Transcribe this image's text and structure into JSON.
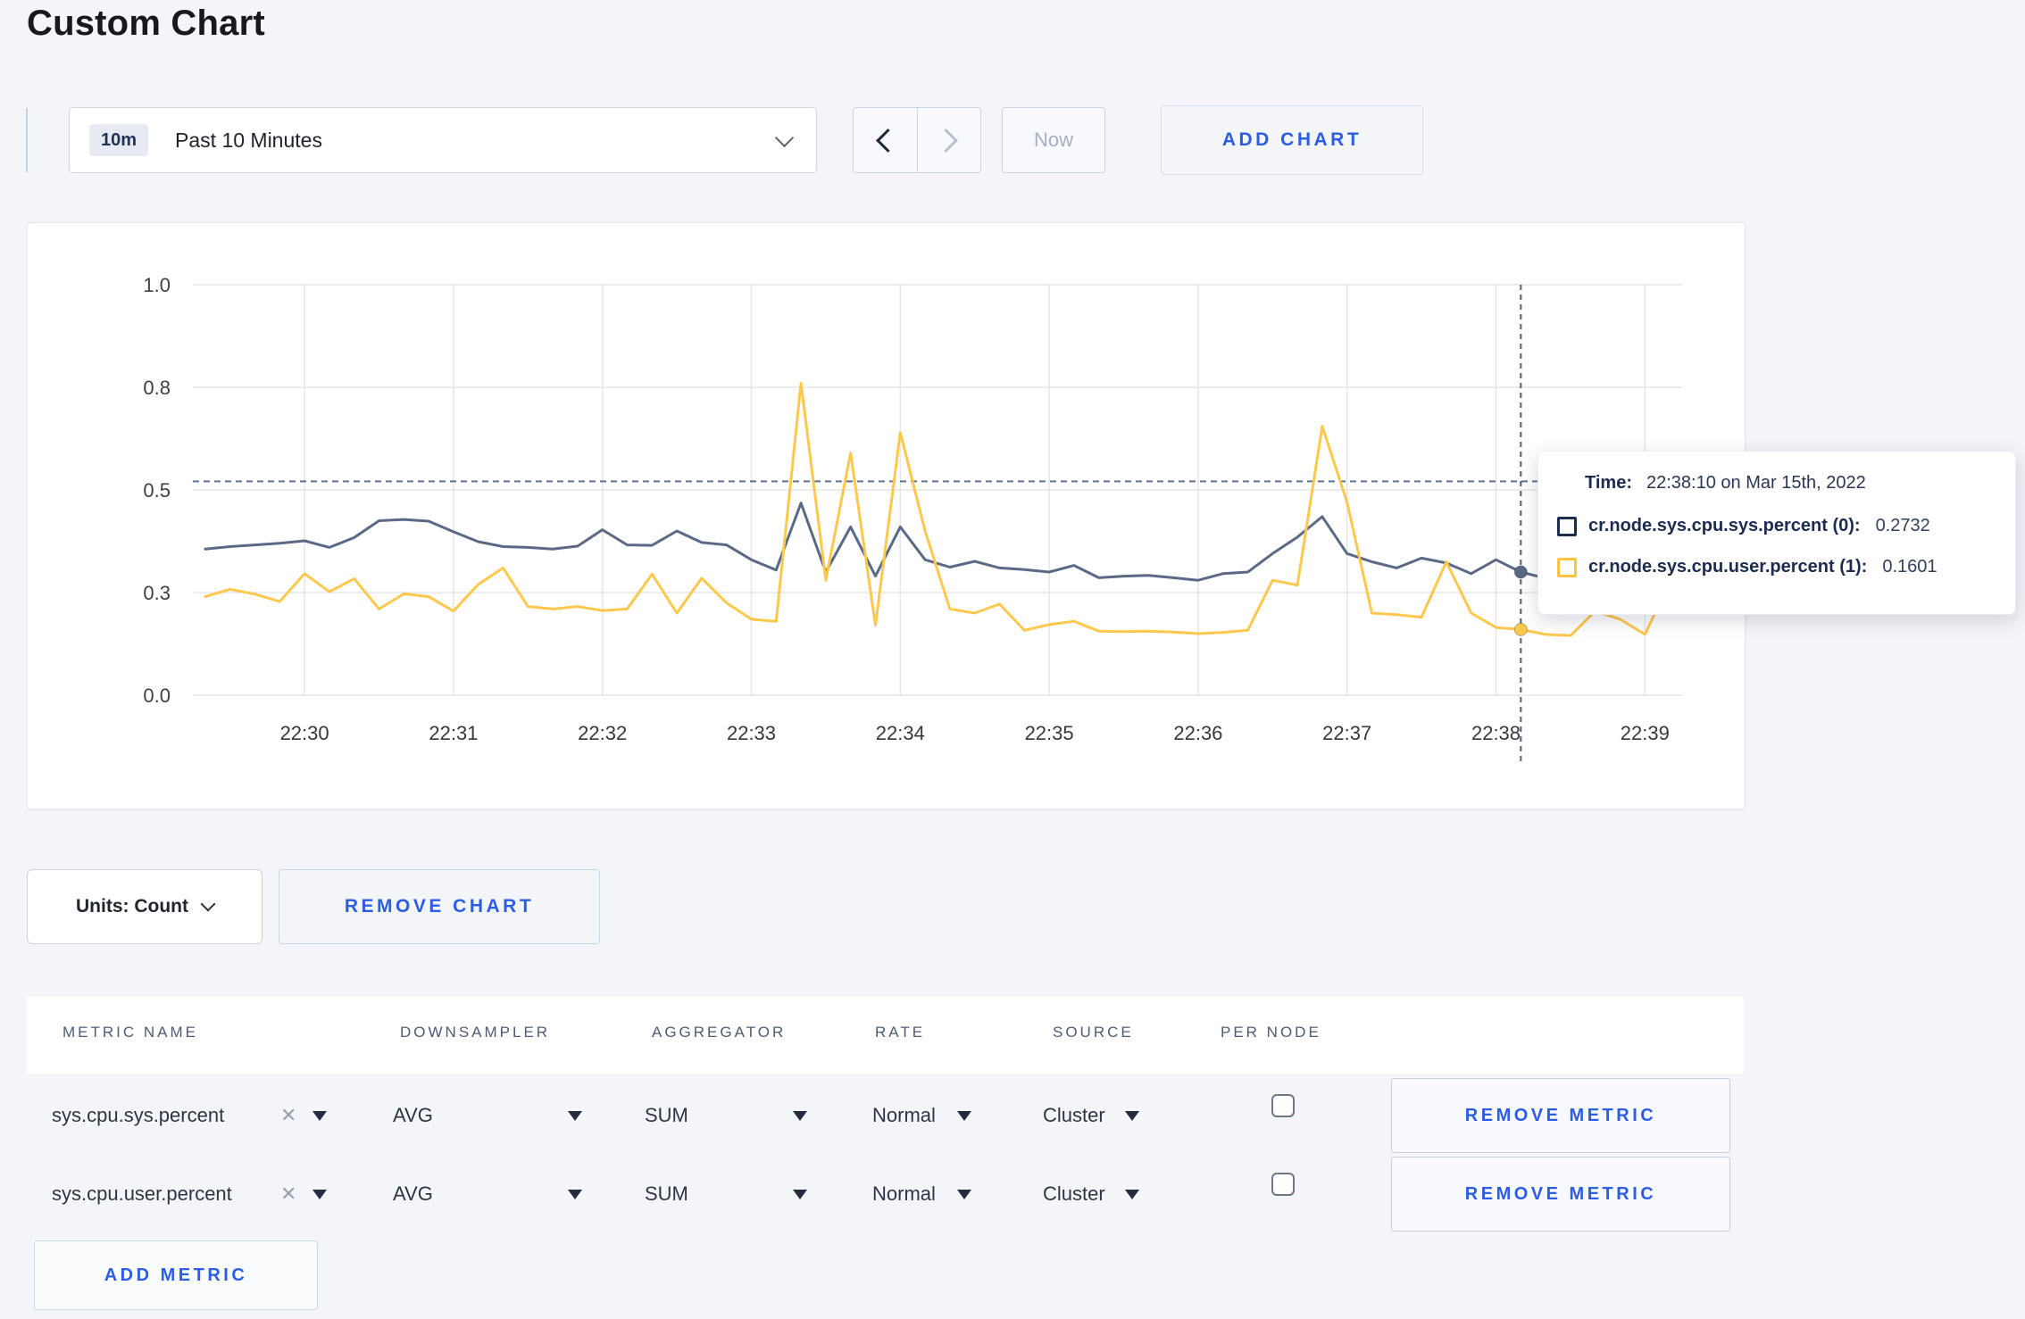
{
  "page": {
    "title": "Custom Chart"
  },
  "toolbar": {
    "time_badge": "10m",
    "time_label": "Past 10 Minutes",
    "prev_icon": "chevron-left",
    "next_icon": "chevron-right",
    "now_label": "Now",
    "add_chart_label": "ADD CHART"
  },
  "tooltip": {
    "time_label": "Time:",
    "time_value": "22:38:10 on Mar 15th, 2022",
    "rows": [
      {
        "label": "cr.node.sys.cpu.sys.percent (0):",
        "value": "0.2732",
        "color": "#1c2c4f"
      },
      {
        "label": "cr.node.sys.cpu.user.percent (1):",
        "value": "0.1601",
        "color": "#ffc53d"
      }
    ]
  },
  "chart_data": {
    "type": "line",
    "x_axis": {
      "tick_labels": [
        "22:30",
        "22:31",
        "22:32",
        "22:33",
        "22:34",
        "22:35",
        "22:36",
        "22:37",
        "22:38",
        "22:39"
      ],
      "tick_positions_minutes": [
        0,
        1,
        2,
        3,
        4,
        5,
        6,
        7,
        8,
        9
      ],
      "domain_minutes": [
        -0.75,
        9.25
      ],
      "unit": "time HH:MM on Mar 15th, 2022"
    },
    "y_axis": {
      "tick_labels": [
        "0.0",
        "0.3",
        "0.5",
        "0.8",
        "1.0"
      ],
      "tick_values": [
        0,
        0.25,
        0.5,
        0.75,
        1.0
      ],
      "range": [
        0,
        1
      ]
    },
    "grid": true,
    "sample_interval_seconds": 10,
    "x_start_offset_minutes": -0.6667,
    "series": [
      {
        "name": "cr.node.sys.cpu.sys.percent",
        "color": "#5a6a86",
        "values": [
          0.356,
          0.362,
          0.366,
          0.37,
          0.376,
          0.36,
          0.384,
          0.425,
          0.428,
          0.424,
          0.398,
          0.374,
          0.362,
          0.36,
          0.356,
          0.363,
          0.403,
          0.366,
          0.365,
          0.4,
          0.372,
          0.366,
          0.33,
          0.305,
          0.468,
          0.3,
          0.41,
          0.29,
          0.41,
          0.33,
          0.312,
          0.326,
          0.31,
          0.306,
          0.3,
          0.316,
          0.286,
          0.29,
          0.292,
          0.286,
          0.28,
          0.296,
          0.3,
          0.345,
          0.385,
          0.435,
          0.345,
          0.325,
          0.31,
          0.334,
          0.322,
          0.296,
          0.33,
          0.3,
          0.285,
          0.292,
          0.315,
          0.296,
          0.3,
          0.302
        ]
      },
      {
        "name": "cr.node.sys.cpu.user.percent",
        "color": "#fec84d",
        "values": [
          0.24,
          0.258,
          0.246,
          0.228,
          0.296,
          0.252,
          0.284,
          0.21,
          0.247,
          0.24,
          0.205,
          0.27,
          0.31,
          0.216,
          0.21,
          0.216,
          0.206,
          0.21,
          0.295,
          0.2,
          0.285,
          0.225,
          0.185,
          0.18,
          0.76,
          0.28,
          0.59,
          0.17,
          0.64,
          0.4,
          0.21,
          0.2,
          0.222,
          0.158,
          0.172,
          0.18,
          0.156,
          0.155,
          0.156,
          0.154,
          0.15,
          0.153,
          0.158,
          0.28,
          0.268,
          0.655,
          0.47,
          0.2,
          0.196,
          0.19,
          0.325,
          0.2,
          0.165,
          0.16,
          0.148,
          0.145,
          0.205,
          0.185,
          0.148,
          0.275
        ]
      }
    ],
    "crosshair": {
      "x_offset_minutes": 8.1667,
      "time": "22:38:10",
      "hline_value": 0.521,
      "marker_values": [
        0.3,
        0.16
      ],
      "hover_readout": {
        "sys": 0.2732,
        "user": 0.1601
      }
    },
    "legend_position": "tooltip"
  },
  "controls": {
    "units_label": "Units: Count",
    "remove_chart_label": "REMOVE CHART"
  },
  "metrics_table": {
    "headers": [
      "METRIC NAME",
      "DOWNSAMPLER",
      "AGGREGATOR",
      "RATE",
      "SOURCE",
      "PER NODE"
    ],
    "clear_icon": "✕",
    "rows": [
      {
        "metric": "sys.cpu.sys.percent",
        "downsampler": "AVG",
        "aggregator": "SUM",
        "rate": "Normal",
        "source": "Cluster",
        "per_node": false,
        "remove_label": "REMOVE METRIC"
      },
      {
        "metric": "sys.cpu.user.percent",
        "downsampler": "AVG",
        "aggregator": "SUM",
        "rate": "Normal",
        "source": "Cluster",
        "per_node": false,
        "remove_label": "REMOVE METRIC"
      }
    ],
    "add_metric_label": "ADD METRIC"
  }
}
